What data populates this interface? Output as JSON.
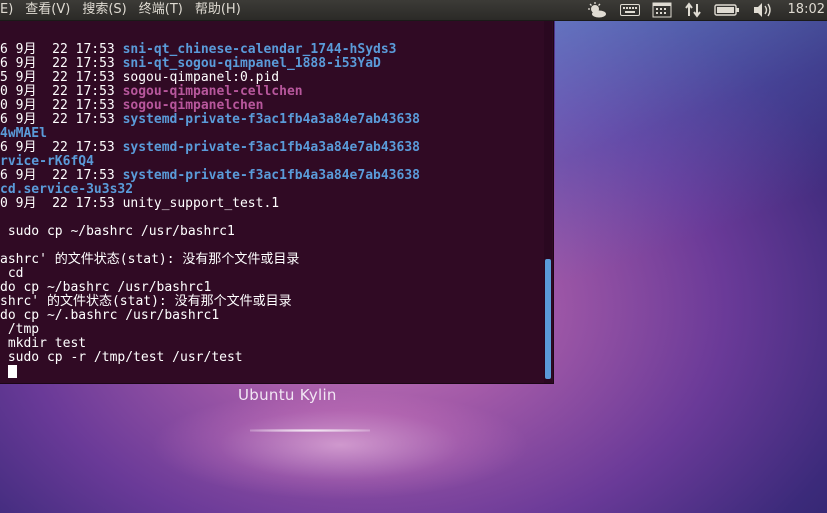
{
  "menu": {
    "items": [
      "E)",
      "查看(V)",
      "搜索(S)",
      "终端(T)",
      "帮助(H)"
    ]
  },
  "indicators": {
    "icons": [
      "weather-icon",
      "keyboard-icon",
      "calendar-icon",
      "network-icon",
      "battery-icon",
      "volume-icon"
    ],
    "clock": "18:02"
  },
  "terminal": {
    "lines": [
      [
        {
          "t": "6 9月  22 17:53 ",
          "c": "white"
        },
        {
          "t": "sni-qt_chinese-calendar_1744-hSyds3",
          "c": "blue"
        }
      ],
      [
        {
          "t": "6 9月  22 17:53 ",
          "c": "white"
        },
        {
          "t": "sni-qt_sogou-qimpanel_1888-i53YaD",
          "c": "blue"
        }
      ],
      [
        {
          "t": "5 9月  22 17:53 sogou-qimpanel:0.pid",
          "c": "white"
        }
      ],
      [
        {
          "t": "0 9月  22 17:53 ",
          "c": "white"
        },
        {
          "t": "sogou-qimpanel-cellchen",
          "c": "pink"
        }
      ],
      [
        {
          "t": "0 9月  22 17:53 ",
          "c": "white"
        },
        {
          "t": "sogou-qimpanelchen",
          "c": "pink"
        }
      ],
      [
        {
          "t": "6 9月  22 17:53 ",
          "c": "white"
        },
        {
          "t": "systemd-private-f3ac1fb4a3a84e7ab43638",
          "c": "blue"
        }
      ],
      [
        {
          "t": "4wMAEl",
          "c": "blue"
        }
      ],
      [
        {
          "t": "6 9月  22 17:53 ",
          "c": "white"
        },
        {
          "t": "systemd-private-f3ac1fb4a3a84e7ab43638",
          "c": "blue"
        }
      ],
      [
        {
          "t": "rvice-rK6fQ4",
          "c": "blue"
        }
      ],
      [
        {
          "t": "6 9月  22 17:53 ",
          "c": "white"
        },
        {
          "t": "systemd-private-f3ac1fb4a3a84e7ab43638",
          "c": "blue"
        }
      ],
      [
        {
          "t": "cd.service-3u3s32",
          "c": "blue"
        }
      ],
      [
        {
          "t": "0 9月  22 17:53 unity_support_test.1",
          "c": "white"
        }
      ],
      [
        {
          "t": "",
          "c": "white"
        }
      ],
      [
        {
          "t": " sudo cp ~/bashrc /usr/bashrc1",
          "c": "white"
        }
      ],
      [
        {
          "t": "",
          "c": "white"
        }
      ],
      [
        {
          "t": "ashrc' 的文件状态(stat): 没有那个文件或目录",
          "c": "white"
        }
      ],
      [
        {
          "t": " cd",
          "c": "white"
        }
      ],
      [
        {
          "t": "do cp ~/bashrc /usr/bashrc1",
          "c": "white"
        }
      ],
      [
        {
          "t": "shrc' 的文件状态(stat): 没有那个文件或目录",
          "c": "white"
        }
      ],
      [
        {
          "t": "do cp ~/.bashrc /usr/bashrc1",
          "c": "white"
        }
      ],
      [
        {
          "t": " /tmp",
          "c": "white"
        }
      ],
      [
        {
          "t": " mkdir test",
          "c": "white"
        }
      ],
      [
        {
          "t": " sudo cp -r /tmp/test /usr/test",
          "c": "white"
        }
      ]
    ]
  },
  "desktop": {
    "distro_label": "Ubuntu Kylin"
  },
  "colors": {
    "terminal_bg": "#300a24",
    "dir_blue": "#5a9bd9",
    "pipe_pink": "#b7579c",
    "panel_bg": "#3c3b37"
  }
}
